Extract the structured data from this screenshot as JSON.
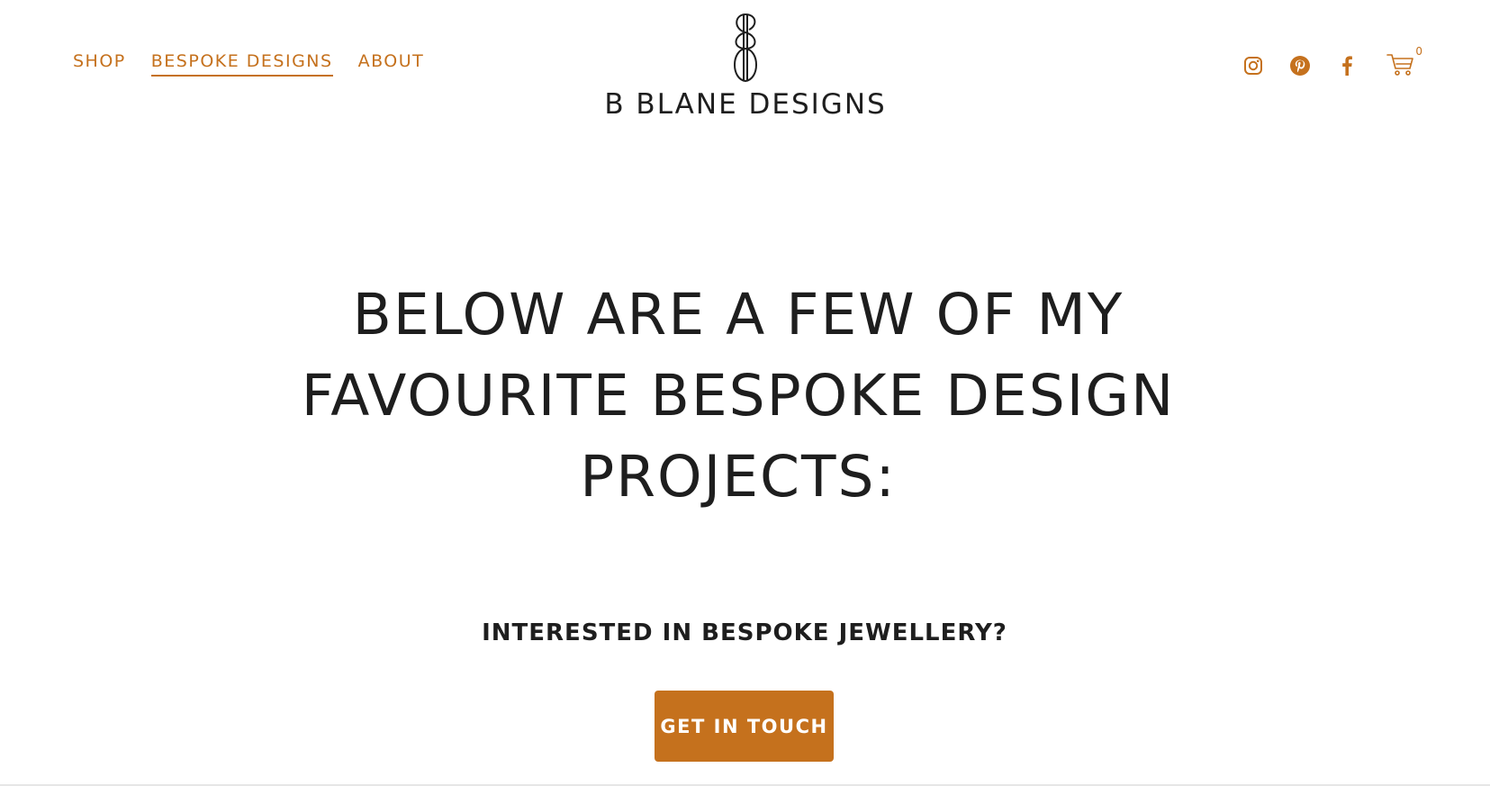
{
  "colors": {
    "accent": "#c5711d",
    "text": "#1e1e1e",
    "background": "#ffffff"
  },
  "nav": {
    "items": [
      {
        "label": "SHOP",
        "active": false
      },
      {
        "label": "BESPOKE DESIGNS",
        "active": true
      },
      {
        "label": "ABOUT",
        "active": false
      }
    ]
  },
  "brand": {
    "name": "B BLANE DESIGNS",
    "icon": "logo-monogram-icon"
  },
  "social": {
    "icons": [
      "instagram-icon",
      "pinterest-icon",
      "facebook-icon"
    ]
  },
  "cart": {
    "icon": "cart-icon",
    "count": "0"
  },
  "hero": {
    "title": "BELOW ARE A FEW OF MY FAVOURITE BESPOKE DESIGN PROJECTS:"
  },
  "cta": {
    "heading": "INTERESTED IN BESPOKE JEWELLERY?",
    "button_label": "GET IN TOUCH"
  }
}
